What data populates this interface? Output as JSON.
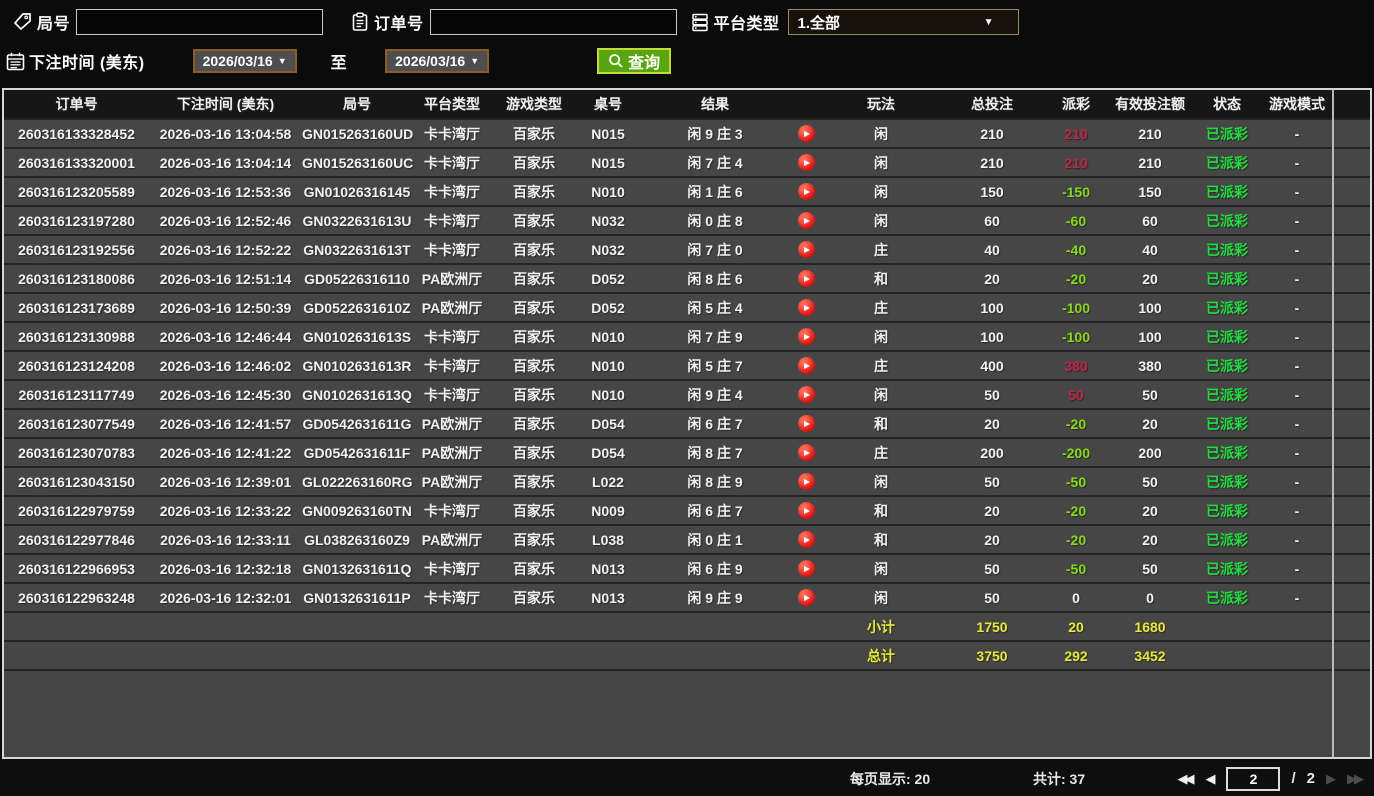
{
  "filters": {
    "round": {
      "label": "局号",
      "value": ""
    },
    "order": {
      "label": "订单号",
      "value": ""
    },
    "platform": {
      "label": "平台类型",
      "value": "1.全部"
    },
    "bet_time": {
      "label": "下注时间 (美东)",
      "from": "2026/03/16",
      "to_label": "至",
      "to": "2026/03/16"
    },
    "query_label": "查询"
  },
  "table": {
    "columns": [
      "订单号",
      "下注时间 (美东)",
      "局号",
      "平台类型",
      "游戏类型",
      "桌号",
      "结果",
      "",
      "玩法",
      "总投注",
      "派彩",
      "有效投注额",
      "状态",
      "游戏模式"
    ],
    "rows": [
      {
        "order_id": "260316133328452",
        "bet_time": "2026-03-16 13:04:58",
        "round_id": "GN015263160UD",
        "platform": "卡卡湾厅",
        "game_type": "百家乐",
        "table_no": "N015",
        "result": "闲 9 庄 3",
        "play_type": "闲",
        "total_bet": "210",
        "payout": "210",
        "payout_color": "red",
        "valid_bet": "210",
        "status": "已派彩",
        "game_mode": "-"
      },
      {
        "order_id": "260316133320001",
        "bet_time": "2026-03-16 13:04:14",
        "round_id": "GN015263160UC",
        "platform": "卡卡湾厅",
        "game_type": "百家乐",
        "table_no": "N015",
        "result": "闲 7 庄 4",
        "play_type": "闲",
        "total_bet": "210",
        "payout": "210",
        "payout_color": "red",
        "valid_bet": "210",
        "status": "已派彩",
        "game_mode": "-"
      },
      {
        "order_id": "260316123205589",
        "bet_time": "2026-03-16 12:53:36",
        "round_id": "GN01026316145",
        "platform": "卡卡湾厅",
        "game_type": "百家乐",
        "table_no": "N010",
        "result": "闲 1 庄 6",
        "play_type": "闲",
        "total_bet": "150",
        "payout": "-150",
        "payout_color": "green",
        "valid_bet": "150",
        "status": "已派彩",
        "game_mode": "-"
      },
      {
        "order_id": "260316123197280",
        "bet_time": "2026-03-16 12:52:46",
        "round_id": "GN0322631613U",
        "platform": "卡卡湾厅",
        "game_type": "百家乐",
        "table_no": "N032",
        "result": "闲 0 庄 8",
        "play_type": "闲",
        "total_bet": "60",
        "payout": "-60",
        "payout_color": "green",
        "valid_bet": "60",
        "status": "已派彩",
        "game_mode": "-"
      },
      {
        "order_id": "260316123192556",
        "bet_time": "2026-03-16 12:52:22",
        "round_id": "GN0322631613T",
        "platform": "卡卡湾厅",
        "game_type": "百家乐",
        "table_no": "N032",
        "result": "闲 7 庄 0",
        "play_type": "庄",
        "total_bet": "40",
        "payout": "-40",
        "payout_color": "green",
        "valid_bet": "40",
        "status": "已派彩",
        "game_mode": "-"
      },
      {
        "order_id": "260316123180086",
        "bet_time": "2026-03-16 12:51:14",
        "round_id": "GD05226316110",
        "platform": "PA欧洲厅",
        "game_type": "百家乐",
        "table_no": "D052",
        "result": "闲 8 庄 6",
        "play_type": "和",
        "total_bet": "20",
        "payout": "-20",
        "payout_color": "green",
        "valid_bet": "20",
        "status": "已派彩",
        "game_mode": "-"
      },
      {
        "order_id": "260316123173689",
        "bet_time": "2026-03-16 12:50:39",
        "round_id": "GD0522631610Z",
        "platform": "PA欧洲厅",
        "game_type": "百家乐",
        "table_no": "D052",
        "result": "闲 5 庄 4",
        "play_type": "庄",
        "total_bet": "100",
        "payout": "-100",
        "payout_color": "green",
        "valid_bet": "100",
        "status": "已派彩",
        "game_mode": "-"
      },
      {
        "order_id": "260316123130988",
        "bet_time": "2026-03-16 12:46:44",
        "round_id": "GN0102631613S",
        "platform": "卡卡湾厅",
        "game_type": "百家乐",
        "table_no": "N010",
        "result": "闲 7 庄 9",
        "play_type": "闲",
        "total_bet": "100",
        "payout": "-100",
        "payout_color": "green",
        "valid_bet": "100",
        "status": "已派彩",
        "game_mode": "-"
      },
      {
        "order_id": "260316123124208",
        "bet_time": "2026-03-16 12:46:02",
        "round_id": "GN0102631613R",
        "platform": "卡卡湾厅",
        "game_type": "百家乐",
        "table_no": "N010",
        "result": "闲 5 庄 7",
        "play_type": "庄",
        "total_bet": "400",
        "payout": "380",
        "payout_color": "red",
        "valid_bet": "380",
        "status": "已派彩",
        "game_mode": "-"
      },
      {
        "order_id": "260316123117749",
        "bet_time": "2026-03-16 12:45:30",
        "round_id": "GN0102631613Q",
        "platform": "卡卡湾厅",
        "game_type": "百家乐",
        "table_no": "N010",
        "result": "闲 9 庄 4",
        "play_type": "闲",
        "total_bet": "50",
        "payout": "50",
        "payout_color": "red",
        "valid_bet": "50",
        "status": "已派彩",
        "game_mode": "-"
      },
      {
        "order_id": "260316123077549",
        "bet_time": "2026-03-16 12:41:57",
        "round_id": "GD0542631611G",
        "platform": "PA欧洲厅",
        "game_type": "百家乐",
        "table_no": "D054",
        "result": "闲 6 庄 7",
        "play_type": "和",
        "total_bet": "20",
        "payout": "-20",
        "payout_color": "green",
        "valid_bet": "20",
        "status": "已派彩",
        "game_mode": "-"
      },
      {
        "order_id": "260316123070783",
        "bet_time": "2026-03-16 12:41:22",
        "round_id": "GD0542631611F",
        "platform": "PA欧洲厅",
        "game_type": "百家乐",
        "table_no": "D054",
        "result": "闲 8 庄 7",
        "play_type": "庄",
        "total_bet": "200",
        "payout": "-200",
        "payout_color": "green",
        "valid_bet": "200",
        "status": "已派彩",
        "game_mode": "-"
      },
      {
        "order_id": "260316123043150",
        "bet_time": "2026-03-16 12:39:01",
        "round_id": "GL022263160RG",
        "platform": "PA欧洲厅",
        "game_type": "百家乐",
        "table_no": "L022",
        "result": "闲 8 庄 9",
        "play_type": "闲",
        "total_bet": "50",
        "payout": "-50",
        "payout_color": "green",
        "valid_bet": "50",
        "status": "已派彩",
        "game_mode": "-"
      },
      {
        "order_id": "260316122979759",
        "bet_time": "2026-03-16 12:33:22",
        "round_id": "GN009263160TN",
        "platform": "卡卡湾厅",
        "game_type": "百家乐",
        "table_no": "N009",
        "result": "闲 6 庄 7",
        "play_type": "和",
        "total_bet": "20",
        "payout": "-20",
        "payout_color": "green",
        "valid_bet": "20",
        "status": "已派彩",
        "game_mode": "-"
      },
      {
        "order_id": "260316122977846",
        "bet_time": "2026-03-16 12:33:11",
        "round_id": "GL038263160Z9",
        "platform": "PA欧洲厅",
        "game_type": "百家乐",
        "table_no": "L038",
        "result": "闲 0 庄 1",
        "play_type": "和",
        "total_bet": "20",
        "payout": "-20",
        "payout_color": "green",
        "valid_bet": "20",
        "status": "已派彩",
        "game_mode": "-"
      },
      {
        "order_id": "260316122966953",
        "bet_time": "2026-03-16 12:32:18",
        "round_id": "GN0132631611Q",
        "platform": "卡卡湾厅",
        "game_type": "百家乐",
        "table_no": "N013",
        "result": "闲 6 庄 9",
        "play_type": "闲",
        "total_bet": "50",
        "payout": "-50",
        "payout_color": "green",
        "valid_bet": "50",
        "status": "已派彩",
        "game_mode": "-"
      },
      {
        "order_id": "260316122963248",
        "bet_time": "2026-03-16 12:32:01",
        "round_id": "GN0132631611P",
        "platform": "卡卡湾厅",
        "game_type": "百家乐",
        "table_no": "N013",
        "result": "闲 9 庄 9",
        "play_type": "闲",
        "total_bet": "50",
        "payout": "0",
        "payout_color": "white",
        "valid_bet": "0",
        "status": "已派彩",
        "game_mode": "-"
      }
    ],
    "subtotal": {
      "label": "小计",
      "total_bet": "1750",
      "payout": "20",
      "valid_bet": "1680"
    },
    "total": {
      "label": "总计",
      "total_bet": "3750",
      "payout": "292",
      "valid_bet": "3452"
    }
  },
  "footer": {
    "per_page_label": "每页显示: 20",
    "total_count_label": "共计: 37",
    "page_current": "2",
    "page_separator": "/",
    "page_total": "2",
    "first_icon": "◀◀",
    "prev_icon": "◀",
    "next_icon": "▶",
    "last_icon": "▶▶"
  },
  "colors": {
    "header_gold": "#d2a452",
    "payout_positive_red": "#c22544",
    "payout_negative_green": "#86d919",
    "status_green": "#21de3f",
    "totals_yellow": "#e8e83a",
    "query_button_green": "#57a50f",
    "query_button_border": "#c6db39",
    "date_button_border": "#8a5c28",
    "row_background": "#464646"
  }
}
